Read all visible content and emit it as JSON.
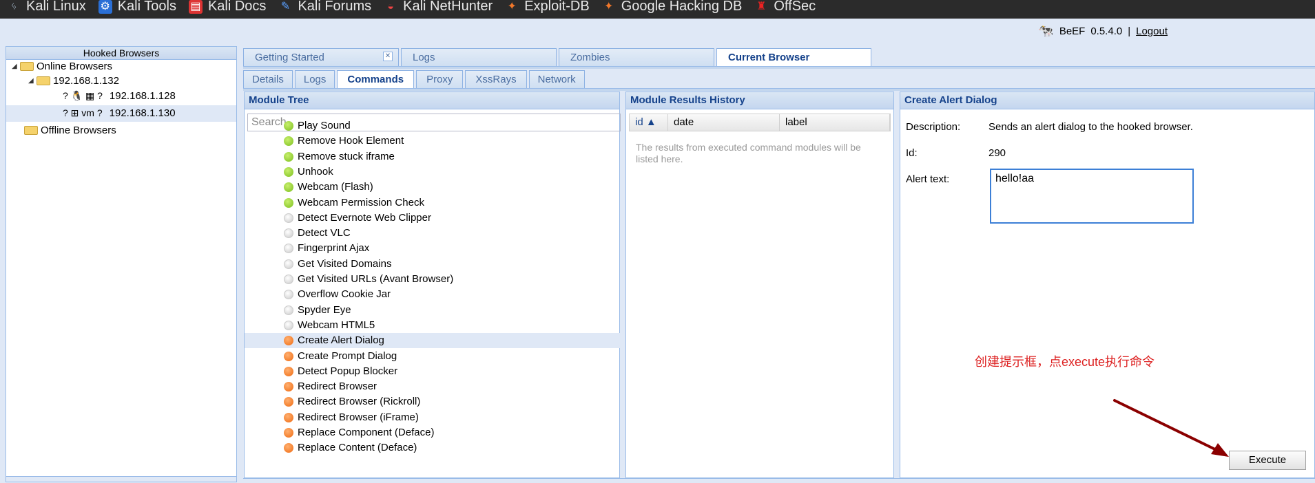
{
  "bookmarks": [
    {
      "label": "Kali Linux",
      "icon": "kali-dragon-icon"
    },
    {
      "label": "Kali Tools",
      "icon": "kali-tools-icon"
    },
    {
      "label": "Kali Docs",
      "icon": "kali-docs-icon"
    },
    {
      "label": "Kali Forums",
      "icon": "kali-forums-icon"
    },
    {
      "label": "Kali NetHunter",
      "icon": "nethunter-icon"
    },
    {
      "label": "Exploit-DB",
      "icon": "exploit-db-icon"
    },
    {
      "label": "Google Hacking DB",
      "icon": "ghdb-icon"
    },
    {
      "label": "OffSec",
      "icon": "offsec-icon"
    }
  ],
  "header": {
    "app": "BeEF",
    "version": "0.5.4.0",
    "separator": "|",
    "logout": "Logout"
  },
  "hooked": {
    "title": "Hooked Browsers",
    "online": "Online Browsers",
    "group": "192.168.1.132",
    "browsers": [
      {
        "ip": "192.168.1.128",
        "icons": "? 🐧 ▦ ?"
      },
      {
        "ip": "192.168.1.130",
        "icons": "? ⊞ vm ?"
      }
    ],
    "offline": "Offline Browsers"
  },
  "main_tabs": [
    {
      "label": "Getting Started",
      "close": "✕"
    },
    {
      "label": "Logs"
    },
    {
      "label": "Zombies"
    },
    {
      "label": "Current Browser"
    }
  ],
  "sub_tabs": [
    "Details",
    "Logs",
    "Commands",
    "Proxy",
    "XssRays",
    "Network"
  ],
  "module_tree": {
    "title": "Module Tree",
    "search_placeholder": "Search",
    "items": [
      {
        "label": "Play Sound",
        "status": "green"
      },
      {
        "label": "Remove Hook Element",
        "status": "green"
      },
      {
        "label": "Remove stuck iframe",
        "status": "green"
      },
      {
        "label": "Unhook",
        "status": "green"
      },
      {
        "label": "Webcam (Flash)",
        "status": "green"
      },
      {
        "label": "Webcam Permission Check",
        "status": "green"
      },
      {
        "label": "Detect Evernote Web Clipper",
        "status": "grey"
      },
      {
        "label": "Detect VLC",
        "status": "grey"
      },
      {
        "label": "Fingerprint Ajax",
        "status": "grey"
      },
      {
        "label": "Get Visited Domains",
        "status": "grey"
      },
      {
        "label": "Get Visited URLs (Avant Browser)",
        "status": "grey"
      },
      {
        "label": "Overflow Cookie Jar",
        "status": "grey"
      },
      {
        "label": "Spyder Eye",
        "status": "grey"
      },
      {
        "label": "Webcam HTML5",
        "status": "grey"
      },
      {
        "label": "Create Alert Dialog",
        "status": "orange"
      },
      {
        "label": "Create Prompt Dialog",
        "status": "orange"
      },
      {
        "label": "Detect Popup Blocker",
        "status": "orange"
      },
      {
        "label": "Redirect Browser",
        "status": "orange"
      },
      {
        "label": "Redirect Browser (Rickroll)",
        "status": "orange"
      },
      {
        "label": "Redirect Browser (iFrame)",
        "status": "orange"
      },
      {
        "label": "Replace Component (Deface)",
        "status": "orange"
      },
      {
        "label": "Replace Content (Deface)",
        "status": "orange"
      }
    ]
  },
  "results": {
    "title": "Module Results History",
    "columns": [
      "id ▲",
      "date",
      "label"
    ],
    "empty": "The results from executed command modules will be listed here."
  },
  "detail": {
    "title": "Create Alert Dialog",
    "description_label": "Description:",
    "description": "Sends an alert dialog to the hooked browser.",
    "id_label": "Id:",
    "id": "290",
    "alert_label": "Alert text:",
    "alert_value": "hello!aa",
    "note": "创建提示框，点execute执行命令",
    "execute": "Execute"
  },
  "colors": {
    "accent": "#15428b",
    "note": "#dd2222",
    "arrow": "#8b0000"
  }
}
